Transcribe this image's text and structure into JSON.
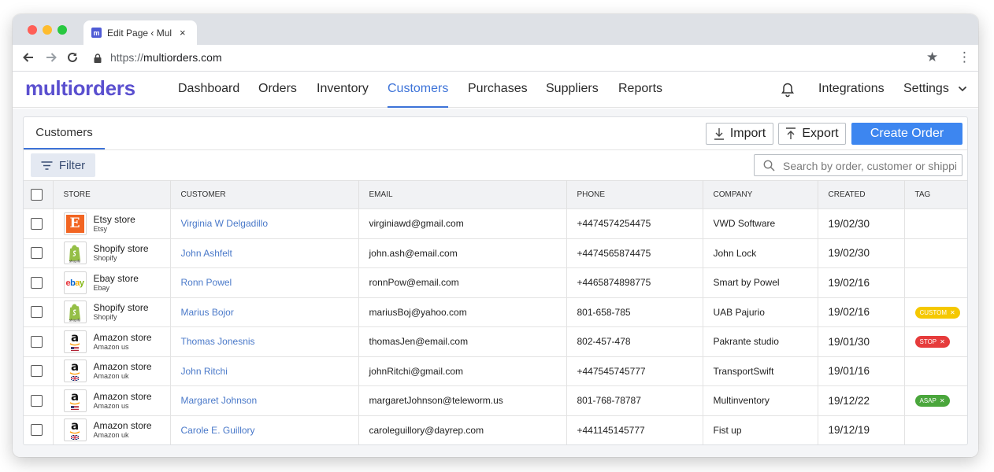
{
  "browser": {
    "tab_title": "Edit Page ‹ Mul",
    "tab_close": "×",
    "tab_favicon_letter": "m",
    "url_protocol": "https://",
    "url_host": "multiorders.com",
    "icons": [
      "back-arrow-icon",
      "forward-arrow-icon",
      "reload-icon",
      "lock-icon",
      "star-icon",
      "kebab-menu-icon"
    ]
  },
  "app": {
    "logo": "multiorders",
    "nav": [
      "Dashboard",
      "Orders",
      "Inventory",
      "Customers",
      "Purchases",
      "Suppliers",
      "Reports"
    ],
    "active_nav": "Customers",
    "integrations": "Integrations",
    "settings": "Settings",
    "accent_color": "#3d73d8",
    "logo_color": "#5a4fcf"
  },
  "panel": {
    "tab": "Customers",
    "import": "Import",
    "export": "Export",
    "create_order": "Create Order",
    "filter": "Filter",
    "search_placeholder": "Search by order, customer or shippi"
  },
  "table": {
    "headers": [
      "STORE",
      "CUSTOMER",
      "EMAIL",
      "PHONE",
      "COMPANY",
      "CREATED",
      "TAG"
    ],
    "rows": [
      {
        "store": "Etsy store",
        "store_sub": "Etsy",
        "store_type": "etsy",
        "customer": "Virginia W Delgadillo",
        "email": "virginiawd@gmail.com",
        "phone": "+4474574254475",
        "company": "VWD Software",
        "created": "19/02/30",
        "tag": null
      },
      {
        "store": "Shopify store",
        "store_sub": "Shopify",
        "store_type": "shopify",
        "customer": "John Ashfelt",
        "email": "john.ash@email.com",
        "phone": "+4474565874475",
        "company": "John Lock",
        "created": "19/02/30",
        "tag": null
      },
      {
        "store": "Ebay store",
        "store_sub": "Ebay",
        "store_type": "ebay",
        "customer": "Ronn Powel",
        "email": "ronnPow@email.com",
        "phone": "+4465874898775",
        "company": "Smart by Powel",
        "created": "19/02/16",
        "tag": null
      },
      {
        "store": "Shopify store",
        "store_sub": "Shopify",
        "store_type": "shopify",
        "customer": "Marius Bojor",
        "email": "mariusBoj@yahoo.com",
        "phone": "801-658-785",
        "company": "UAB Pajurio",
        "created": "19/02/16",
        "tag": {
          "label": "CUSTOM",
          "color": "#f5c800"
        }
      },
      {
        "store": "Amazon store",
        "store_sub": "Amazon us",
        "store_type": "amazon-us",
        "customer": "Thomas Jonesnis",
        "email": "thomasJen@email.com",
        "phone": "802-457-478",
        "company": "Pakrante studio",
        "created": "19/01/30",
        "tag": {
          "label": "STOP",
          "color": "#e63b3b"
        }
      },
      {
        "store": "Amazon store",
        "store_sub": "Amazon uk",
        "store_type": "amazon-uk",
        "customer": "John Ritchi",
        "email": "johnRitchi@gmail.com",
        "phone": "+447545745777",
        "company": "TransportSwift",
        "created": "19/01/16",
        "tag": null
      },
      {
        "store": "Amazon store",
        "store_sub": "Amazon us",
        "store_type": "amazon-us",
        "customer": "Margaret Johnson",
        "email": "margaretJohnson@teleworm.us",
        "phone": "801-768-78787",
        "company": "Multinventory",
        "created": "19/12/22",
        "tag": {
          "label": "ASAP",
          "color": "#4aa63c"
        }
      },
      {
        "store": "Amazon store",
        "store_sub": "Amazon uk",
        "store_type": "amazon-uk",
        "customer": "Carole E. Guillory",
        "email": "caroleguillory@dayrep.com",
        "phone": "+441145145777",
        "company": "Fist up",
        "created": "19/12/19",
        "tag": null
      }
    ]
  }
}
